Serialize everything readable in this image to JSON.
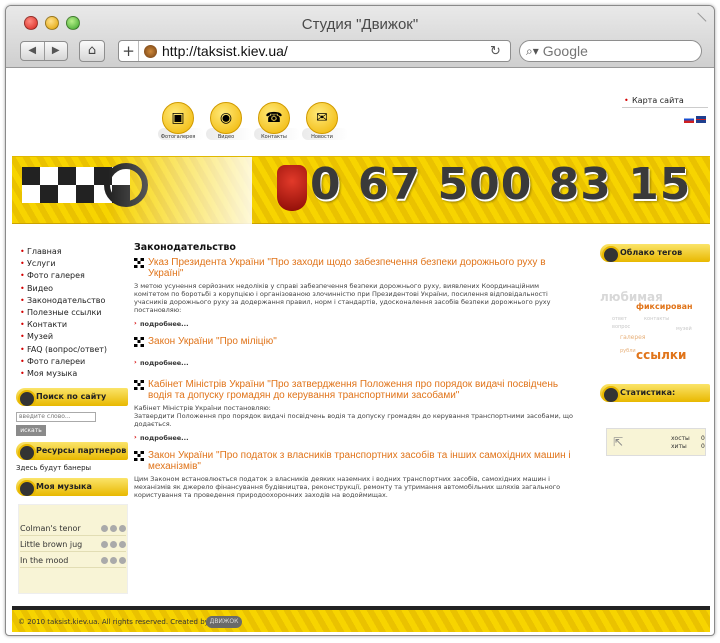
{
  "browser": {
    "title": "Студия \"Движок\"",
    "url": "http://taksist.kiev.ua/",
    "search_placeholder": "Google"
  },
  "top": {
    "sitemap": "Карта сайта",
    "topics": [
      "Фотогалерея",
      "Видео",
      "Контакты",
      "Новости"
    ]
  },
  "banner": {
    "phone": "0 67 500 83 15"
  },
  "nav": {
    "items": [
      "Главная",
      "Услуги",
      "Фото галерея",
      "Видео",
      "Законодательство",
      "Полезные ссылки",
      "Контакти",
      "Музей",
      "FAQ (вопрос/ответ)",
      "Фото галереи",
      "Моя музыка"
    ]
  },
  "sidebar": {
    "search_title": "Поиск по сайту",
    "search_placeholder": "введите слово...",
    "search_button": "искать",
    "partners_title": "Ресурсы партнеров",
    "partners_note": "Здесь будут банеры",
    "music_title": "Моя музыка",
    "tracks": [
      "Colman's tenor",
      "Little brown jug",
      "In the mood"
    ]
  },
  "content": {
    "title": "Законодательство",
    "more": "подробнее...",
    "articles": [
      {
        "title": "Указ Президента України \"Про заходи щодо забезпечення безпеки дорожнього руху в Україні\"",
        "body": "З метою усунення серйозних недоліків у справі забезпечення безпеки дорожнього руху, виявлених Координаційним комітетом по боротьбі з корупцією і організованою злочинністю при Президентові України, посилення відповідальності учасників дорожнього руху за додержання правил, норм і стандартів, удосконалення засобів безпеки дорожнього руху постановляю:"
      },
      {
        "title": "Закон України \"Про міліцію\"",
        "body": ""
      },
      {
        "title": "Кабінет Міністрів України \"Про затвердження Положення про порядок видачі посвідчень водія та допуску громадян до керування транспортними засобами\"",
        "body": "Кабінет Міністрів України постановляю:\nЗатвердити Положення про порядок видачі посвідчень водія та допуску громадян до керування транспортними засобами, що додається."
      },
      {
        "title": "Закон України \"Про податок з власників транспортних засобів та інших самохідних машин і механізмів\"",
        "body": "Цим Законом встановлюється податок з власників деяких наземних і водних транспортних засобів, самохідних машин і механізмів як джерело фінансування будівництва, реконструкції, ремонту та утримання автомобільних шляхів загального користування та проведення природоохоронних заходів на водоймищах."
      }
    ]
  },
  "right": {
    "cloud_title": "Облако тегов",
    "tags": [
      "любимая",
      "фиксирован",
      "ссылки",
      "галерея",
      "рубли",
      "ответ",
      "вопрос",
      "контакты",
      "музей"
    ],
    "stats_title": "Статистика:",
    "stats_labels": [
      "хосты",
      "хиты"
    ],
    "stats_values": [
      "0",
      "0"
    ]
  },
  "footer": {
    "text": "© 2010 taksist.kiev.ua. All rights reserved. Created by",
    "logo": "ДВИЖОК"
  }
}
